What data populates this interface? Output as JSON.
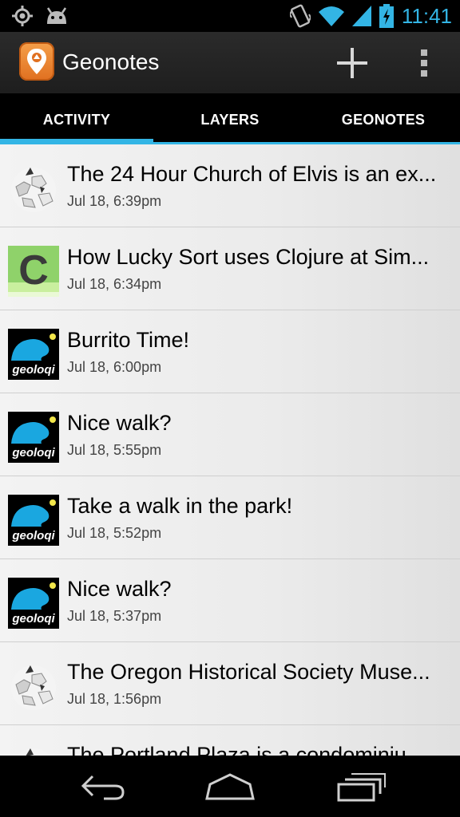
{
  "status_bar": {
    "time": "11:41",
    "icons": [
      "gps-icon",
      "android-debug-icon",
      "vibrate-icon",
      "wifi-icon",
      "signal-icon",
      "battery-charging-icon"
    ]
  },
  "action_bar": {
    "title": "Geonotes",
    "app_icon": "geonotes-app-icon",
    "actions": [
      "add-icon",
      "overflow-menu-icon"
    ]
  },
  "tabs": [
    {
      "label": "ACTIVITY",
      "active": true
    },
    {
      "label": "LAYERS",
      "active": false
    },
    {
      "label": "GEONOTES",
      "active": false
    }
  ],
  "accent_color": "#33b5e5",
  "list": [
    {
      "title": "The 24 Hour Church of Elvis is an ex...",
      "time": "Jul 18, 6:39pm",
      "thumb": "wikipedia-globe-icon"
    },
    {
      "title": "How Lucky Sort uses Clojure at Sim...",
      "time": "Jul 18, 6:34pm",
      "thumb": "clojure-c-icon"
    },
    {
      "title": "Burrito Time!",
      "time": "Jul 18, 6:00pm",
      "thumb": "geoloqi-dino-icon"
    },
    {
      "title": "Nice walk?",
      "time": "Jul 18, 5:55pm",
      "thumb": "geoloqi-dino-icon"
    },
    {
      "title": "Take a walk in the park!",
      "time": "Jul 18, 5:52pm",
      "thumb": "geoloqi-dino-icon"
    },
    {
      "title": "Nice walk?",
      "time": "Jul 18, 5:37pm",
      "thumb": "geoloqi-dino-icon"
    },
    {
      "title": "The Oregon Historical Society Muse...",
      "time": "Jul 18, 1:56pm",
      "thumb": "wikipedia-globe-icon"
    },
    {
      "title": "The Portland Plaza is a condominiu...",
      "time": "",
      "thumb": "wikipedia-globe-icon"
    }
  ],
  "thumb_text": {
    "geoloqi": "geoloqi",
    "clojure": "C"
  },
  "nav_bar": [
    "back-icon",
    "home-icon",
    "recent-apps-icon"
  ]
}
